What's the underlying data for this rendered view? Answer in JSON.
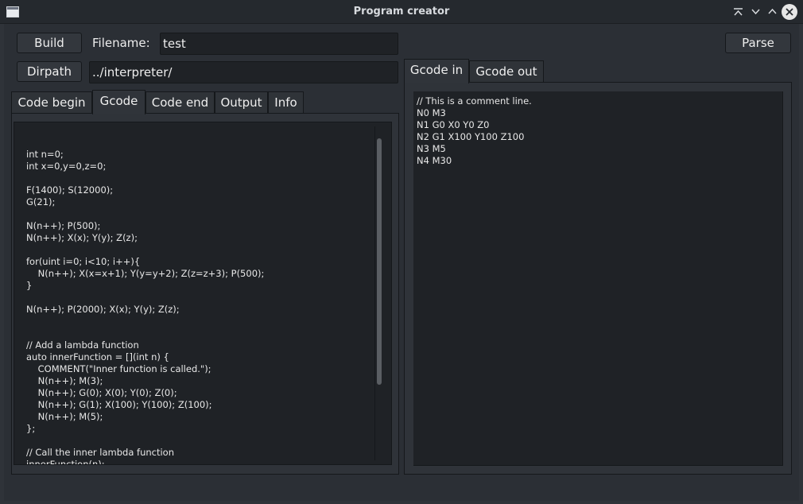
{
  "window": {
    "title": "Program creator"
  },
  "toolbar": {
    "build_label": "Build",
    "filename_label": "Filename:",
    "filename_value": "test",
    "parse_label": "Parse",
    "dirpath_label": "Dirpath",
    "dirpath_value": "../interpreter/"
  },
  "left_tabs": {
    "tabs": [
      {
        "label": "Code begin"
      },
      {
        "label": "Gcode"
      },
      {
        "label": "Code end"
      },
      {
        "label": "Output"
      },
      {
        "label": "Info"
      }
    ],
    "active_tab": "Gcode"
  },
  "right_tabs": {
    "tabs": [
      {
        "label": "Gcode in"
      },
      {
        "label": "Gcode out"
      }
    ],
    "active_tab": "Gcode in"
  },
  "gcode_editor": {
    "text": "int n=0;\nint x=0,y=0,z=0;\n\nF(1400); S(12000);\nG(21);\n\nN(n++); P(500);\nN(n++); X(x); Y(y); Z(z);\n\nfor(uint i=0; i<10; i++){\n    N(n++); X(x=x+1); Y(y=y+2); Z(z=z+3); P(500);\n}\n\nN(n++); P(2000); X(x); Y(y); Z(z);\n\n\n// Add a lambda function\nauto innerFunction = [](int n) {\n    COMMENT(\"Inner function is called.\");\n    N(n++); M(3);\n    N(n++); G(0); X(0); Y(0); Z(0);\n    N(n++); G(1); X(100); Y(100); Z(100);\n    N(n++); M(5);\n};\n\n// Call the inner lambda function\ninnerFunction(n);"
  },
  "gcode_in_view": {
    "text": "// This is a comment line.\nN0 M3\nN1 G0 X0 Y0 Z0\nN2 G1 X100 Y100 Z100\nN3 M5\nN4 M30"
  }
}
